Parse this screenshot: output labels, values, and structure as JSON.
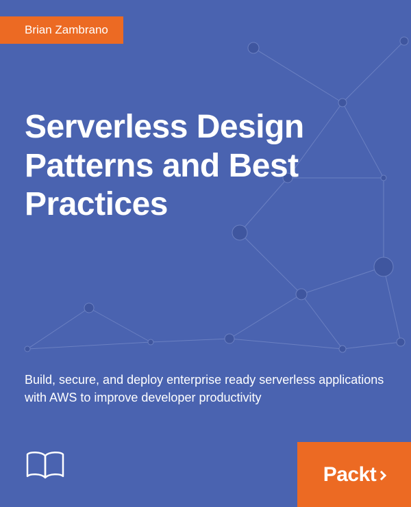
{
  "author": "Brian Zambrano",
  "title": "Serverless Design Patterns and Best Practices",
  "subtitle": "Build, secure, and deploy enterprise ready serverless applications with AWS to improve developer productivity",
  "publisher": "Packt",
  "colors": {
    "background": "#4a63b0",
    "accent": "#ec6a23",
    "text": "#ffffff"
  }
}
